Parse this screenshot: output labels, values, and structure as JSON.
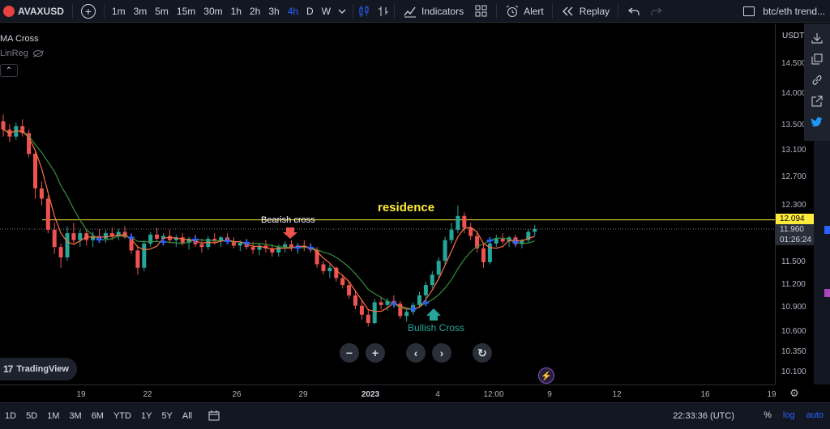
{
  "toolbar": {
    "symbol": "AVAXUSD",
    "timeframes": [
      "1m",
      "3m",
      "5m",
      "15m",
      "30m",
      "1h",
      "2h",
      "3h",
      "4h",
      "D",
      "W"
    ],
    "active_timeframe": "4h",
    "indicators_label": "Indicators",
    "alert_label": "Alert",
    "replay_label": "Replay",
    "layout_name": "btc/eth trend..."
  },
  "legend": {
    "title": "MA Cross",
    "sub": "LinReg"
  },
  "annotations": {
    "bearish": "Bearish cross",
    "residence": "residence",
    "bullish": "Bullish Cross"
  },
  "brand": "TradingView",
  "price_axis": {
    "currency": "USDT",
    "ticks": [
      "14.500",
      "14.000",
      "13.500",
      "13.100",
      "12.700",
      "12.300",
      "11.500",
      "11.200",
      "10.900",
      "10.600",
      "10.350",
      "10.100"
    ],
    "resistance_price": "12.094",
    "last_price": "11.960",
    "countdown": "01:26:24"
  },
  "time_axis": {
    "ticks": [
      "19",
      "22",
      "26",
      "29",
      "2023",
      "4",
      "12:00",
      "9",
      "12",
      "16",
      "19"
    ]
  },
  "bottom": {
    "ranges": [
      "1D",
      "5D",
      "1M",
      "3M",
      "6M",
      "YTD",
      "1Y",
      "5Y",
      "All"
    ],
    "clock": "22:33:36 (UTC)",
    "percent": "%",
    "log": "log",
    "auto": "auto"
  },
  "colors": {
    "bull": "#26a69a",
    "bear": "#ef5350",
    "resistance": "#ffeb3b",
    "ma_fast": "#ff7043",
    "ma_slow": "#388e3c",
    "cross_marker": "#2962ff"
  },
  "chart_data": {
    "type": "candlestick",
    "ylim": [
      10.0,
      14.7
    ],
    "resistance": 12.094,
    "last": 11.96,
    "candles": [
      [
        13.52,
        13.62,
        13.3,
        13.4
      ],
      [
        13.4,
        13.48,
        13.22,
        13.3
      ],
      [
        13.3,
        13.5,
        13.25,
        13.45
      ],
      [
        13.45,
        13.55,
        13.3,
        13.35
      ],
      [
        13.35,
        13.4,
        13.0,
        13.05
      ],
      [
        13.05,
        13.1,
        12.4,
        12.55
      ],
      [
        12.55,
        12.65,
        12.3,
        12.4
      ],
      [
        12.4,
        12.45,
        11.9,
        11.95
      ],
      [
        11.95,
        12.05,
        11.6,
        11.7
      ],
      [
        11.7,
        11.75,
        11.4,
        11.55
      ],
      [
        11.55,
        12.0,
        11.5,
        11.9
      ],
      [
        11.9,
        12.05,
        11.75,
        11.8
      ],
      [
        11.8,
        11.95,
        11.7,
        11.9
      ],
      [
        11.9,
        11.95,
        11.72,
        11.8
      ],
      [
        11.8,
        11.92,
        11.7,
        11.86
      ],
      [
        11.86,
        11.96,
        11.78,
        11.82
      ],
      [
        11.82,
        11.95,
        11.76,
        11.9
      ],
      [
        11.9,
        11.98,
        11.8,
        11.85
      ],
      [
        11.85,
        11.96,
        11.8,
        11.92
      ],
      [
        11.92,
        12.0,
        11.82,
        11.84
      ],
      [
        11.84,
        11.9,
        11.6,
        11.65
      ],
      [
        11.65,
        11.72,
        11.3,
        11.4
      ],
      [
        11.4,
        11.8,
        11.35,
        11.75
      ],
      [
        11.75,
        11.92,
        11.7,
        11.88
      ],
      [
        11.88,
        11.98,
        11.78,
        11.82
      ],
      [
        11.82,
        11.9,
        11.72,
        11.86
      ],
      [
        11.86,
        11.95,
        11.75,
        11.8
      ],
      [
        11.8,
        11.88,
        11.7,
        11.84
      ],
      [
        11.84,
        11.9,
        11.72,
        11.76
      ],
      [
        11.76,
        11.85,
        11.66,
        11.82
      ],
      [
        11.82,
        11.88,
        11.7,
        11.74
      ],
      [
        11.74,
        11.82,
        11.62,
        11.7
      ],
      [
        11.7,
        11.86,
        11.66,
        11.82
      ],
      [
        11.82,
        11.9,
        11.74,
        11.78
      ],
      [
        11.78,
        11.86,
        11.7,
        11.84
      ],
      [
        11.84,
        11.9,
        11.74,
        11.78
      ],
      [
        11.78,
        11.84,
        11.68,
        11.72
      ],
      [
        11.72,
        11.8,
        11.64,
        11.76
      ],
      [
        11.76,
        11.82,
        11.66,
        11.7
      ],
      [
        11.7,
        11.78,
        11.6,
        11.66
      ],
      [
        11.66,
        11.76,
        11.58,
        11.72
      ],
      [
        11.72,
        11.8,
        11.62,
        11.68
      ],
      [
        11.68,
        11.74,
        11.56,
        11.62
      ],
      [
        11.62,
        11.74,
        11.56,
        11.7
      ],
      [
        11.7,
        11.78,
        11.62,
        11.74
      ],
      [
        11.74,
        11.8,
        11.64,
        11.68
      ],
      [
        11.68,
        11.76,
        11.6,
        11.72
      ],
      [
        11.72,
        11.8,
        11.64,
        11.7
      ],
      [
        11.7,
        11.76,
        11.62,
        11.66
      ],
      [
        11.66,
        11.7,
        11.4,
        11.45
      ],
      [
        11.45,
        11.5,
        11.3,
        11.35
      ],
      [
        11.35,
        11.45,
        11.25,
        11.4
      ],
      [
        11.4,
        11.42,
        11.2,
        11.25
      ],
      [
        11.25,
        11.3,
        11.1,
        11.15
      ],
      [
        11.15,
        11.2,
        10.95,
        11.0
      ],
      [
        11.0,
        11.08,
        10.8,
        10.85
      ],
      [
        10.85,
        10.92,
        10.65,
        10.72
      ],
      [
        10.72,
        10.8,
        10.55,
        10.6
      ],
      [
        10.6,
        10.95,
        10.58,
        10.9
      ],
      [
        10.9,
        10.98,
        10.8,
        10.86
      ],
      [
        10.86,
        10.96,
        10.78,
        10.92
      ],
      [
        10.92,
        11.0,
        10.82,
        10.88
      ],
      [
        10.88,
        10.92,
        10.66,
        10.7
      ],
      [
        10.7,
        10.8,
        10.62,
        10.76
      ],
      [
        10.76,
        10.9,
        10.72,
        10.86
      ],
      [
        10.86,
        11.05,
        10.82,
        11.0
      ],
      [
        11.0,
        11.2,
        10.96,
        11.15
      ],
      [
        11.15,
        11.35,
        11.1,
        11.3
      ],
      [
        11.3,
        11.55,
        11.25,
        11.5
      ],
      [
        11.5,
        11.85,
        11.45,
        11.8
      ],
      [
        11.8,
        12.05,
        11.75,
        11.95
      ],
      [
        11.95,
        12.3,
        11.9,
        12.15
      ],
      [
        12.15,
        12.2,
        11.9,
        11.98
      ],
      [
        11.98,
        12.05,
        11.8,
        11.86
      ],
      [
        11.86,
        11.92,
        11.62,
        11.68
      ],
      [
        11.68,
        11.75,
        11.4,
        11.48
      ],
      [
        11.48,
        11.8,
        11.45,
        11.75
      ],
      [
        11.75,
        11.88,
        11.7,
        11.82
      ],
      [
        11.82,
        11.9,
        11.74,
        11.78
      ],
      [
        11.78,
        11.86,
        11.7,
        11.84
      ],
      [
        11.84,
        11.88,
        11.7,
        11.74
      ],
      [
        11.74,
        11.82,
        11.68,
        11.8
      ],
      [
        11.8,
        11.96,
        11.76,
        11.92
      ],
      [
        11.92,
        12.02,
        11.86,
        11.96
      ]
    ]
  }
}
